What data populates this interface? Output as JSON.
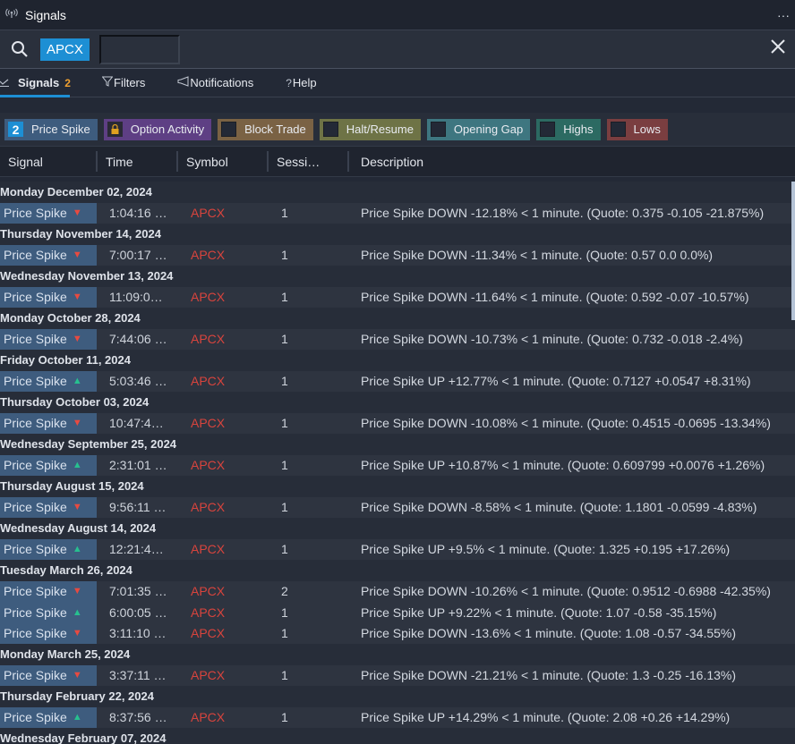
{
  "window": {
    "title": "Signals",
    "icon": "antenna-icon",
    "more_label": "···"
  },
  "search": {
    "ticker": "APCX",
    "input_value": "",
    "input_placeholder": ""
  },
  "tabs": [
    {
      "label": "Signals",
      "badge": "2",
      "icon": "chart-line-icon",
      "active": true
    },
    {
      "label": "Filters",
      "icon": "filter-icon"
    },
    {
      "label": "Notifications",
      "icon": "megaphone-icon"
    },
    {
      "label": "Help",
      "icon": "question-icon"
    }
  ],
  "filters": [
    {
      "label": "Price Spike",
      "marker": "2",
      "color": "#3e5c7e"
    },
    {
      "label": "Option Activity",
      "marker": "lock",
      "color": "#5e3f84"
    },
    {
      "label": "Block Trade",
      "marker": "",
      "color": "#7a6244"
    },
    {
      "label": "Halt/Resume",
      "marker": "",
      "color": "#6e7346"
    },
    {
      "label": "Opening Gap",
      "marker": "",
      "color": "#3e7680"
    },
    {
      "label": "Highs",
      "marker": "",
      "color": "#2c6a62"
    },
    {
      "label": "Lows",
      "marker": "",
      "color": "#7a3e40"
    }
  ],
  "columns": [
    "Signal",
    "Time",
    "Symbol",
    "Sessi…",
    "Description"
  ],
  "groups": [
    {
      "date": "Monday December 02, 2024",
      "rows": [
        {
          "signal": "Price Spike",
          "dir": "down",
          "time": "1:04:16 …",
          "symbol": "APCX",
          "session": "1",
          "desc": "Price Spike DOWN -12.18% < 1 minute. (Quote: 0.375 -0.105 -21.875%)"
        }
      ]
    },
    {
      "date": "Thursday November 14, 2024",
      "rows": [
        {
          "signal": "Price Spike",
          "dir": "down",
          "time": "7:00:17 …",
          "symbol": "APCX",
          "session": "1",
          "desc": "Price Spike DOWN -11.34% < 1 minute. (Quote: 0.57 0.0 0.0%)"
        }
      ]
    },
    {
      "date": "Wednesday November 13, 2024",
      "rows": [
        {
          "signal": "Price Spike",
          "dir": "down",
          "time": "11:09:0…",
          "symbol": "APCX",
          "session": "1",
          "desc": "Price Spike DOWN -11.64% < 1 minute. (Quote: 0.592 -0.07 -10.57%)"
        }
      ]
    },
    {
      "date": "Monday October 28, 2024",
      "rows": [
        {
          "signal": "Price Spike",
          "dir": "down",
          "time": "7:44:06 …",
          "symbol": "APCX",
          "session": "1",
          "desc": "Price Spike DOWN -10.73% < 1 minute. (Quote: 0.732 -0.018 -2.4%)"
        }
      ]
    },
    {
      "date": "Friday October 11, 2024",
      "rows": [
        {
          "signal": "Price Spike",
          "dir": "up",
          "time": "5:03:46 …",
          "symbol": "APCX",
          "session": "1",
          "desc": "Price Spike UP +12.77% < 1 minute. (Quote: 0.7127 +0.0547 +8.31%)"
        }
      ]
    },
    {
      "date": "Thursday October 03, 2024",
      "rows": [
        {
          "signal": "Price Spike",
          "dir": "down",
          "time": "10:47:4…",
          "symbol": "APCX",
          "session": "1",
          "desc": "Price Spike DOWN -10.08% < 1 minute. (Quote: 0.4515 -0.0695 -13.34%)"
        }
      ]
    },
    {
      "date": "Wednesday September 25, 2024",
      "rows": [
        {
          "signal": "Price Spike",
          "dir": "up",
          "time": "2:31:01 …",
          "symbol": "APCX",
          "session": "1",
          "desc": "Price Spike UP +10.87% < 1 minute. (Quote: 0.609799 +0.0076 +1.26%)"
        }
      ]
    },
    {
      "date": "Thursday August 15, 2024",
      "rows": [
        {
          "signal": "Price Spike",
          "dir": "down",
          "time": "9:56:11 …",
          "symbol": "APCX",
          "session": "1",
          "desc": "Price Spike DOWN -8.58% < 1 minute. (Quote: 1.1801 -0.0599 -4.83%)"
        }
      ]
    },
    {
      "date": "Wednesday August 14, 2024",
      "rows": [
        {
          "signal": "Price Spike",
          "dir": "up",
          "time": "12:21:4…",
          "symbol": "APCX",
          "session": "1",
          "desc": "Price Spike UP +9.5% < 1 minute. (Quote: 1.325 +0.195 +17.26%)"
        }
      ]
    },
    {
      "date": "Tuesday March 26, 2024",
      "rows": [
        {
          "signal": "Price Spike",
          "dir": "down",
          "time": "7:01:35 …",
          "symbol": "APCX",
          "session": "2",
          "desc": "Price Spike DOWN -10.26% < 1 minute. (Quote: 0.9512 -0.6988 -42.35%)"
        },
        {
          "signal": "Price Spike",
          "dir": "up",
          "time": "6:00:05 …",
          "symbol": "APCX",
          "session": "1",
          "desc": "Price Spike UP +9.22% < 1 minute. (Quote: 1.07 -0.58 -35.15%)"
        },
        {
          "signal": "Price Spike",
          "dir": "down",
          "time": "3:11:10 …",
          "symbol": "APCX",
          "session": "1",
          "desc": "Price Spike DOWN -13.6% < 1 minute. (Quote: 1.08 -0.57 -34.55%)"
        }
      ]
    },
    {
      "date": "Monday March 25, 2024",
      "rows": [
        {
          "signal": "Price Spike",
          "dir": "down",
          "time": "3:37:11 …",
          "symbol": "APCX",
          "session": "1",
          "desc": "Price Spike DOWN -21.21% < 1 minute. (Quote: 1.3 -0.25 -16.13%)"
        }
      ]
    },
    {
      "date": "Thursday February 22, 2024",
      "rows": [
        {
          "signal": "Price Spike",
          "dir": "up",
          "time": "8:37:56 …",
          "symbol": "APCX",
          "session": "1",
          "desc": "Price Spike UP +14.29% < 1 minute. (Quote: 2.08 +0.26 +14.29%)"
        }
      ]
    },
    {
      "date": "Wednesday February 07, 2024",
      "rows": []
    }
  ],
  "glyphs": {
    "down": "▼",
    "up": "▲"
  }
}
